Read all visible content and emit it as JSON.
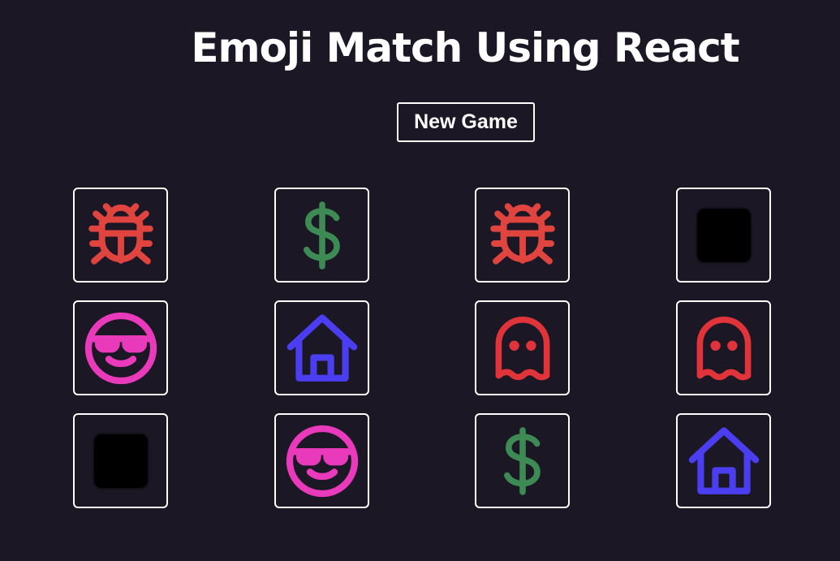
{
  "header": {
    "title": "Emoji Match Using React"
  },
  "controls": {
    "new_game_label": "New Game"
  },
  "colors": {
    "background": "#1b1724",
    "card_border": "#ffffff",
    "bug": "#e0443e",
    "dollar": "#3d8a54",
    "face": "#e83aba",
    "house": "#4a3ef0",
    "ghost": "#e0343a",
    "hidden": "#000000"
  },
  "board": {
    "columns": 4,
    "rows": 3,
    "cards": [
      {
        "icon": "bug-icon",
        "state": "revealed"
      },
      {
        "icon": "dollar-icon",
        "state": "revealed"
      },
      {
        "icon": "bug-icon",
        "state": "revealed"
      },
      {
        "icon": "hidden",
        "state": "hidden"
      },
      {
        "icon": "cool-face-icon",
        "state": "revealed"
      },
      {
        "icon": "house-icon",
        "state": "revealed"
      },
      {
        "icon": "ghost-icon",
        "state": "revealed"
      },
      {
        "icon": "ghost-icon",
        "state": "revealed"
      },
      {
        "icon": "hidden",
        "state": "hidden"
      },
      {
        "icon": "cool-face-icon",
        "state": "revealed"
      },
      {
        "icon": "dollar-icon",
        "state": "revealed"
      },
      {
        "icon": "house-icon",
        "state": "revealed"
      }
    ]
  }
}
